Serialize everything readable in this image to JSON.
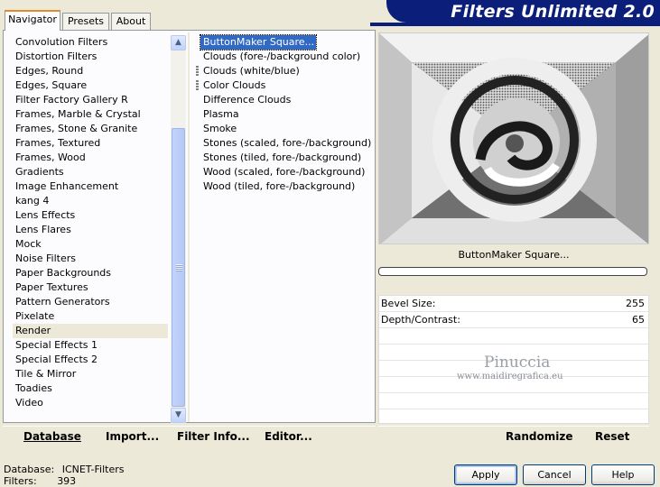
{
  "header": {
    "title": "Filters Unlimited 2.0",
    "tabs": [
      {
        "label": "Navigator",
        "active": true
      },
      {
        "label": "Presets",
        "active": false
      },
      {
        "label": "About",
        "active": false
      }
    ]
  },
  "categories": {
    "items": [
      "Convolution Filters",
      "Distortion Filters",
      "Edges, Round",
      "Edges, Square",
      "Filter Factory Gallery R",
      "Frames, Marble & Crystal",
      "Frames, Stone & Granite",
      "Frames, Textured",
      "Frames, Wood",
      "Gradients",
      "Image Enhancement",
      "kang 4",
      "Lens Effects",
      "Lens Flares",
      "Mock",
      "Noise Filters",
      "Paper Backgrounds",
      "Paper Textures",
      "Pattern Generators",
      "Pixelate",
      "Render",
      "Special Effects 1",
      "Special Effects 2",
      "Tile & Mirror",
      "Toadies",
      "Video"
    ],
    "selected": "Render",
    "scroll_up_icon": "arrow-up-icon",
    "scroll_down_icon": "arrow-down-icon"
  },
  "filters": {
    "items": [
      "ButtonMaker Square...",
      "Clouds (fore-/background color)",
      "Clouds (white/blue)",
      "Color Clouds",
      "Difference Clouds",
      "Plasma",
      "Smoke",
      "Stones (scaled, fore-/background)",
      "Stones (tiled, fore-/background)",
      "Wood (scaled, fore-/background)",
      "Wood (tiled, fore-/background)"
    ],
    "selected": "ButtonMaker Square...",
    "grip_items": [
      "Clouds (white/blue)",
      "Color Clouds"
    ]
  },
  "preview": {
    "filter_name": "ButtonMaker Square...",
    "progress": 0
  },
  "params": [
    {
      "label": "Bevel Size:",
      "value": "255"
    },
    {
      "label": "Depth/Contrast:",
      "value": "65"
    }
  ],
  "watermark": {
    "name": "Pinuccia",
    "url": "www.maidiregrafica.eu"
  },
  "left_buttons": {
    "database": "Database",
    "import": "Import...",
    "filter_info": "Filter Info...",
    "editor": "Editor..."
  },
  "right_buttons": {
    "randomize": "Randomize",
    "reset": "Reset"
  },
  "status": {
    "database_label": "Database:",
    "database_value": "ICNET-Filters",
    "filters_label": "Filters:",
    "filters_value": "393"
  },
  "dialog_buttons": {
    "apply": "Apply",
    "cancel": "Cancel",
    "help": "Help"
  },
  "colors": {
    "banner": "#0b1f7a",
    "selection": "#316ac5",
    "tab_accent": "#e68b2c"
  }
}
